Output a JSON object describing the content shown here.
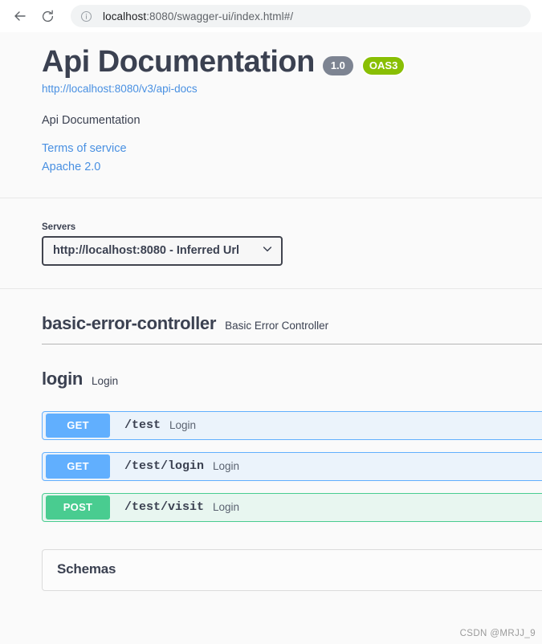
{
  "browser": {
    "back_icon": "back-arrow-icon",
    "reload_icon": "reload-icon",
    "site_info_icon": "info-circle-icon",
    "url_host": "localhost",
    "url_rest": ":8080/swagger-ui/index.html#/"
  },
  "info": {
    "title": "Api Documentation",
    "version_badge": "1.0",
    "spec_badge": "OAS3",
    "docs_url": "http://localhost:8080/v3/api-docs",
    "description": "Api Documentation",
    "terms_link": "Terms of service",
    "license_link": "Apache 2.0"
  },
  "servers": {
    "label": "Servers",
    "selected": "http://localhost:8080 - Inferred Url",
    "chevron_icon": "chevron-down-icon"
  },
  "tags": [
    {
      "name": "basic-error-controller",
      "description": "Basic Error Controller",
      "operations": []
    },
    {
      "name": "login",
      "description": "Login",
      "operations": [
        {
          "method": "GET",
          "path": "/test",
          "summary": "Login"
        },
        {
          "method": "GET",
          "path": "/test/login",
          "summary": "Login"
        },
        {
          "method": "POST",
          "path": "/test/visit",
          "summary": "Login"
        }
      ]
    }
  ],
  "schemas": {
    "title": "Schemas"
  },
  "watermark": "CSDN @MRJJ_9",
  "colors": {
    "get": "#61affe",
    "post": "#49cc90",
    "oas_badge": "#89bf04",
    "version_badge": "#7d8492",
    "link": "#4990e2",
    "text": "#3b4151"
  }
}
